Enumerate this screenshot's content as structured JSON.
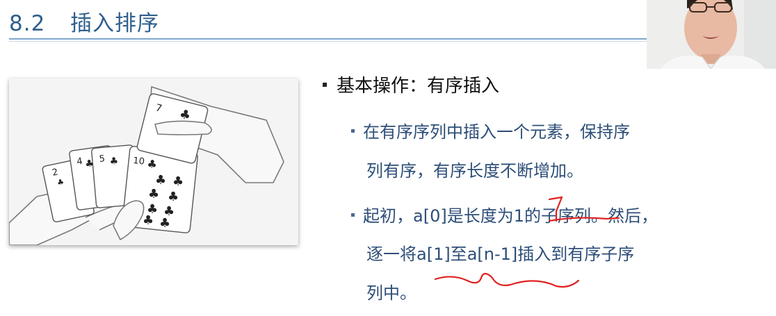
{
  "title": {
    "number": "8.2",
    "text": "插入排序"
  },
  "main_bullet": "基本操作：有序插入",
  "sub_bullets": [
    {
      "line1": "在有序序列中插入一个元素，保持序",
      "line2": "列有序，有序长度不断增加。"
    },
    {
      "line1": "起初，a[0]是长度为1的子序列。然后，",
      "line2": "逐一将a[1]至a[n-1]插入到有序子序",
      "line3": "列中。"
    }
  ],
  "illustration": {
    "cards": [
      {
        "rank": "2",
        "suit": "♣"
      },
      {
        "rank": "4",
        "suit": "♣"
      },
      {
        "rank": "5",
        "suit": "♣"
      },
      {
        "rank": "10",
        "suit": "♣"
      },
      {
        "rank": "7",
        "suit": "♣"
      }
    ]
  },
  "colors": {
    "title": "#2f5f8e",
    "body_text": "#2d4e78",
    "ink": "#e02020"
  }
}
